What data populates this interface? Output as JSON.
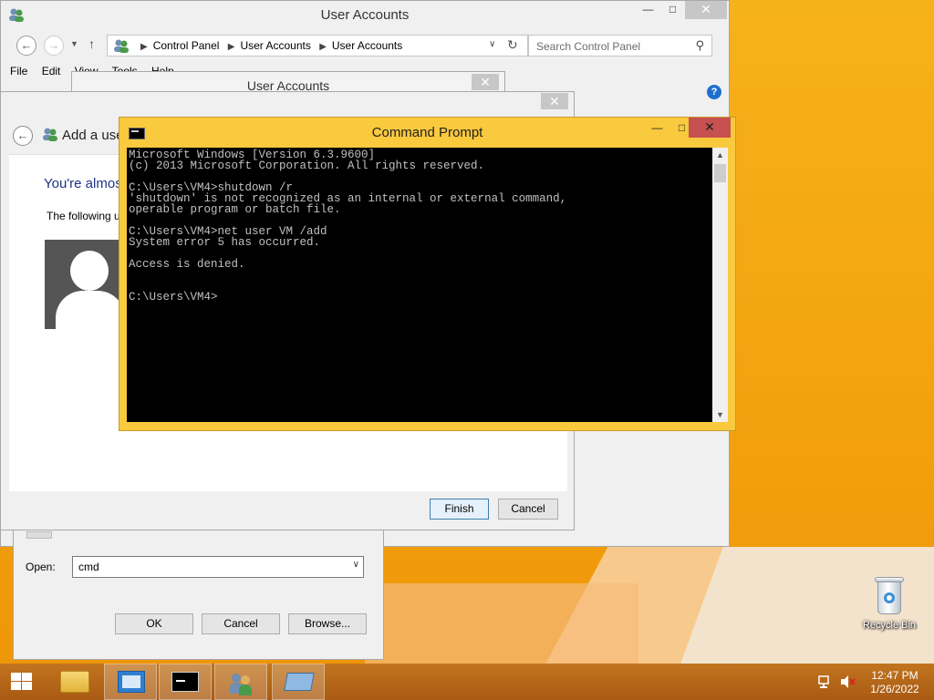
{
  "desktop": {
    "recycle_bin_label": "Recycle Bin"
  },
  "user_accounts": {
    "title": "User Accounts",
    "address": {
      "crumbs": [
        "Control Panel",
        "User Accounts",
        "User Accounts"
      ]
    },
    "search_placeholder": "Search Control Panel",
    "menu": [
      "File",
      "Edit",
      "View",
      "Tools",
      "Help"
    ],
    "help_symbol": "?"
  },
  "user_accounts_2": {
    "title": "User Accounts"
  },
  "add_user": {
    "title": "Add a user",
    "heading": "You're almost done.",
    "description": "The following user will be able to sign in to this PC:",
    "finish_label": "Finish",
    "cancel_label": "Cancel"
  },
  "run_dialog": {
    "open_label": "Open:",
    "open_value": "cmd",
    "ok_label": "OK",
    "cancel_label": "Cancel",
    "browse_label": "Browse..."
  },
  "command_prompt": {
    "title": "Command Prompt",
    "output": "Microsoft Windows [Version 6.3.9600]\n(c) 2013 Microsoft Corporation. All rights reserved.\n\nC:\\Users\\VM4>shutdown /r\n'shutdown' is not recognized as an internal or external command,\noperable program or batch file.\n\nC:\\Users\\VM4>net user VM /add\nSystem error 5 has occurred.\n\nAccess is denied.\n\n\nC:\\Users\\VM4>"
  },
  "taskbar": {
    "time": "12:47 PM",
    "date": "1/26/2022"
  }
}
